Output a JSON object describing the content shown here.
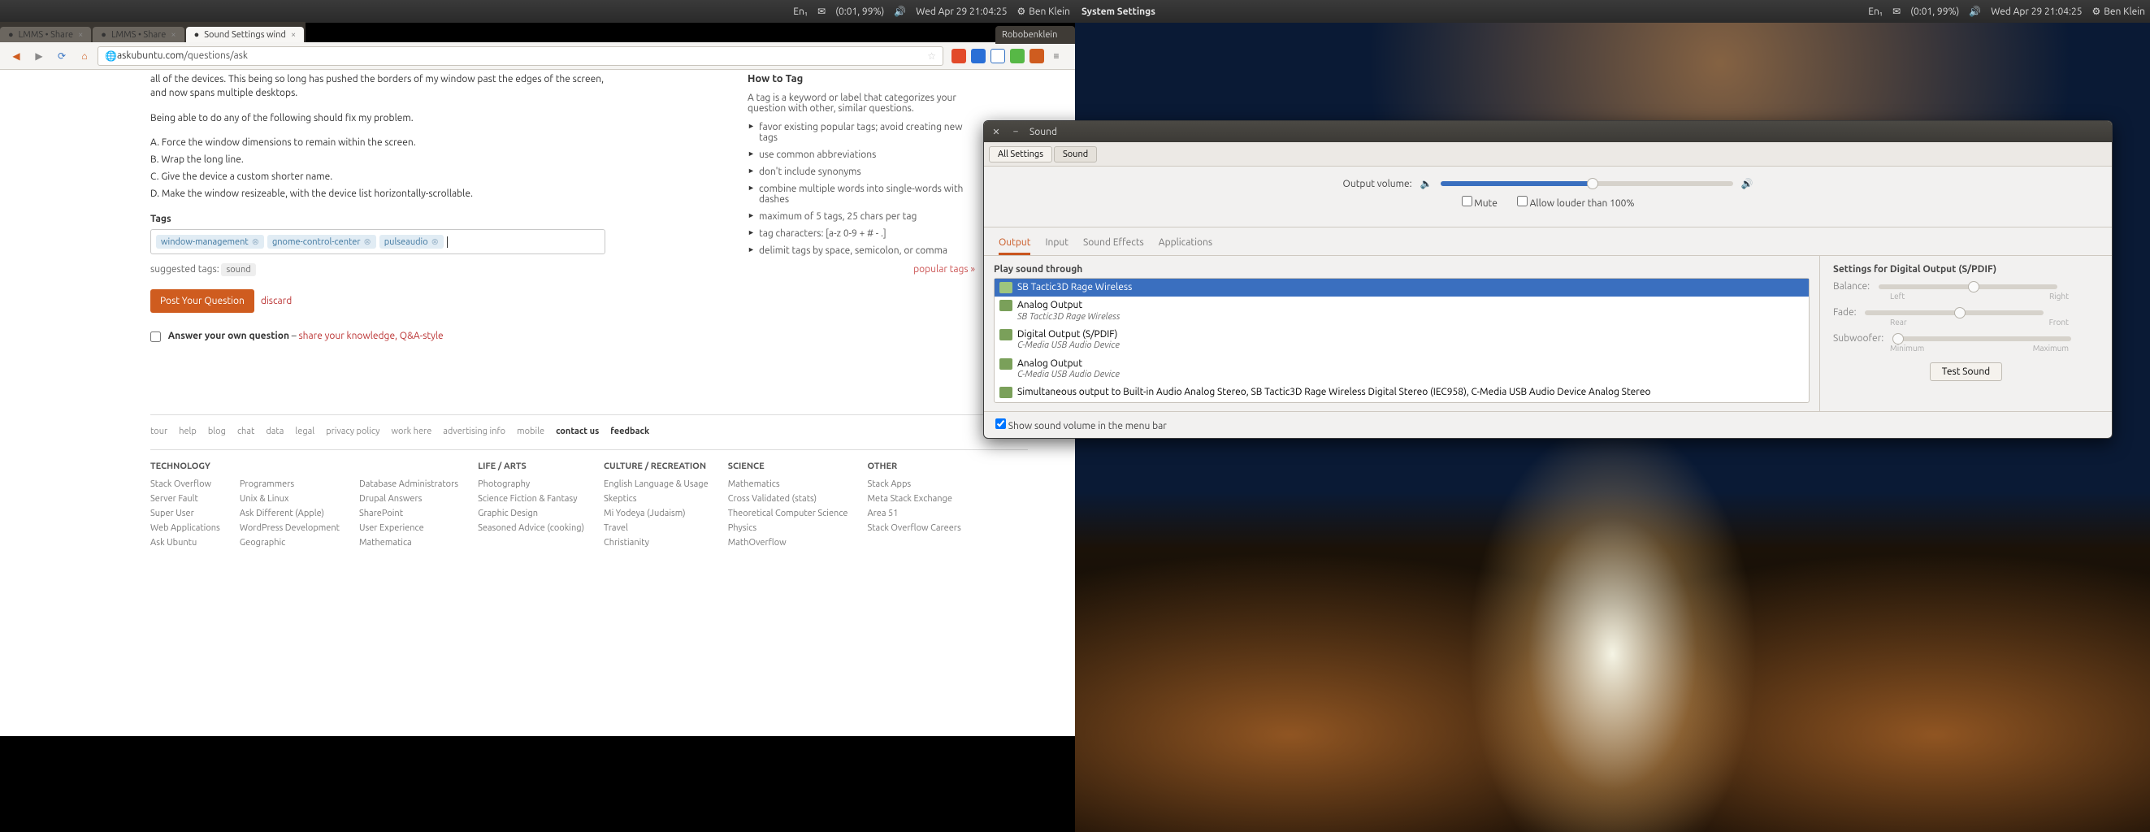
{
  "topbar_left": {
    "app_title": "",
    "battery": "(0:01, 99%)",
    "lang": "En₁",
    "datetime": "Wed Apr 29 21:04:25",
    "user": "Ben Klein"
  },
  "topbar_right": {
    "app_title": "System Settings",
    "battery": "(0:01, 99%)",
    "lang": "En₁",
    "datetime": "Wed Apr 29 21:04:25",
    "user": "Ben Klein"
  },
  "tabs": [
    {
      "title": "LMMS • Share"
    },
    {
      "title": "LMMS • Share"
    },
    {
      "title": "Sound Settings wind",
      "active": true
    }
  ],
  "url": {
    "domain": "askubuntu.com",
    "path": "/questions/ask"
  },
  "post": {
    "body_line1": "all of the devices. This being so long has pushed the borders of my window past the edges of the screen, and now spans multiple desktops.",
    "body_line2": "Being able to do any of the following should fix my problem.",
    "body_a": "A. Force the window dimensions to remain within the screen.",
    "body_b": "B. Wrap the long line.",
    "body_c": "C. Give the device a custom shorter name.",
    "body_d": "D. Make the window resizeable, with the device list horizontally-scrollable.",
    "tags_label": "Tags",
    "tags": [
      "window-management",
      "gnome-control-center",
      "pulseaudio"
    ],
    "suggested_label": "suggested tags:",
    "suggested": [
      "sound"
    ],
    "post_btn": "Post Your Question",
    "discard": "discard",
    "answer_own": "Answer your own question",
    "answer_link": "share your knowledge, Q&A-style"
  },
  "tips": {
    "heading": "How to Tag",
    "intro": "A tag is a keyword or label that categorizes your question with other, similar questions.",
    "items": [
      "favor existing popular tags; avoid creating new tags",
      "use common abbreviations",
      "don't include synonyms",
      "combine multiple words into single-words with dashes",
      "maximum of 5 tags, 25 chars per tag",
      "tag characters: [a-z 0-9 + # - .]",
      "delimit tags by space, semicolon, or comma"
    ],
    "popular": "popular tags »"
  },
  "footer_nav": [
    "tour",
    "help",
    "blog",
    "chat",
    "data",
    "legal",
    "privacy policy",
    "work here",
    "advertising info",
    "mobile",
    "contact us",
    "feedback"
  ],
  "footer_cols": [
    {
      "head": "TECHNOLOGY",
      "links": [
        "Stack Overflow",
        "Server Fault",
        "Super User",
        "Web Applications",
        "Ask Ubuntu"
      ]
    },
    {
      "head": "",
      "links": [
        "Programmers",
        "Unix & Linux",
        "Ask Different (Apple)",
        "WordPress Development",
        "Geographic"
      ]
    },
    {
      "head": "",
      "links": [
        "Database Administrators",
        "Drupal Answers",
        "SharePoint",
        "User Experience",
        "Mathematica"
      ]
    },
    {
      "head": "LIFE / ARTS",
      "links": [
        "Photography",
        "Science Fiction & Fantasy",
        "Graphic Design",
        "Seasoned Advice (cooking)"
      ]
    },
    {
      "head": "CULTURE / RECREATION",
      "links": [
        "English Language & Usage",
        "Skeptics",
        "Mi Yodeya (Judaism)",
        "Travel",
        "Christianity"
      ]
    },
    {
      "head": "SCIENCE",
      "links": [
        "Mathematics",
        "Cross Validated (stats)",
        "Theoretical Computer Science",
        "Physics",
        "MathOverflow"
      ]
    },
    {
      "head": "OTHER",
      "links": [
        "Stack Apps",
        "Meta Stack Exchange",
        "Area 51",
        "Stack Overflow Careers"
      ]
    }
  ],
  "filewin_title": "Robobenklein",
  "sound": {
    "title": "Sound",
    "crumb_all": "All Settings",
    "crumb_here": "Sound",
    "output_volume_label": "Output volume:",
    "volume_pct": 52,
    "mute": "Mute",
    "allow_louder": "Allow louder than 100%",
    "tabs": [
      "Output",
      "Input",
      "Sound Effects",
      "Applications"
    ],
    "active_tab": 0,
    "play_through": "Play sound through",
    "devices": [
      {
        "name": "SB Tactic3D Rage Wireless",
        "sub": "",
        "sel": true
      },
      {
        "name": "Analog Output",
        "sub": "SB Tactic3D Rage Wireless"
      },
      {
        "name": "Digital Output (S/PDIF)",
        "sub": "C-Media USB Audio Device"
      },
      {
        "name": "Analog Output",
        "sub": "C-Media USB Audio Device"
      },
      {
        "name": "Simultaneous output to Built-in Audio Analog Stereo, SB Tactic3D Rage Wireless Digital Stereo (IEC958), C-Media USB Audio Device   Analog Stereo",
        "sub": ""
      }
    ],
    "settings_heading": "Settings for Digital Output (S/PDIF)",
    "balance_label": "Balance:",
    "balance_left": "Left",
    "balance_right": "Right",
    "fade_label": "Fade:",
    "fade_rear": "Rear",
    "fade_front": "Front",
    "sub_label": "Subwoofer:",
    "sub_min": "Minimum",
    "sub_max": "Maximum",
    "test_btn": "Test Sound",
    "show_volume": "Show sound volume in the menu bar"
  }
}
